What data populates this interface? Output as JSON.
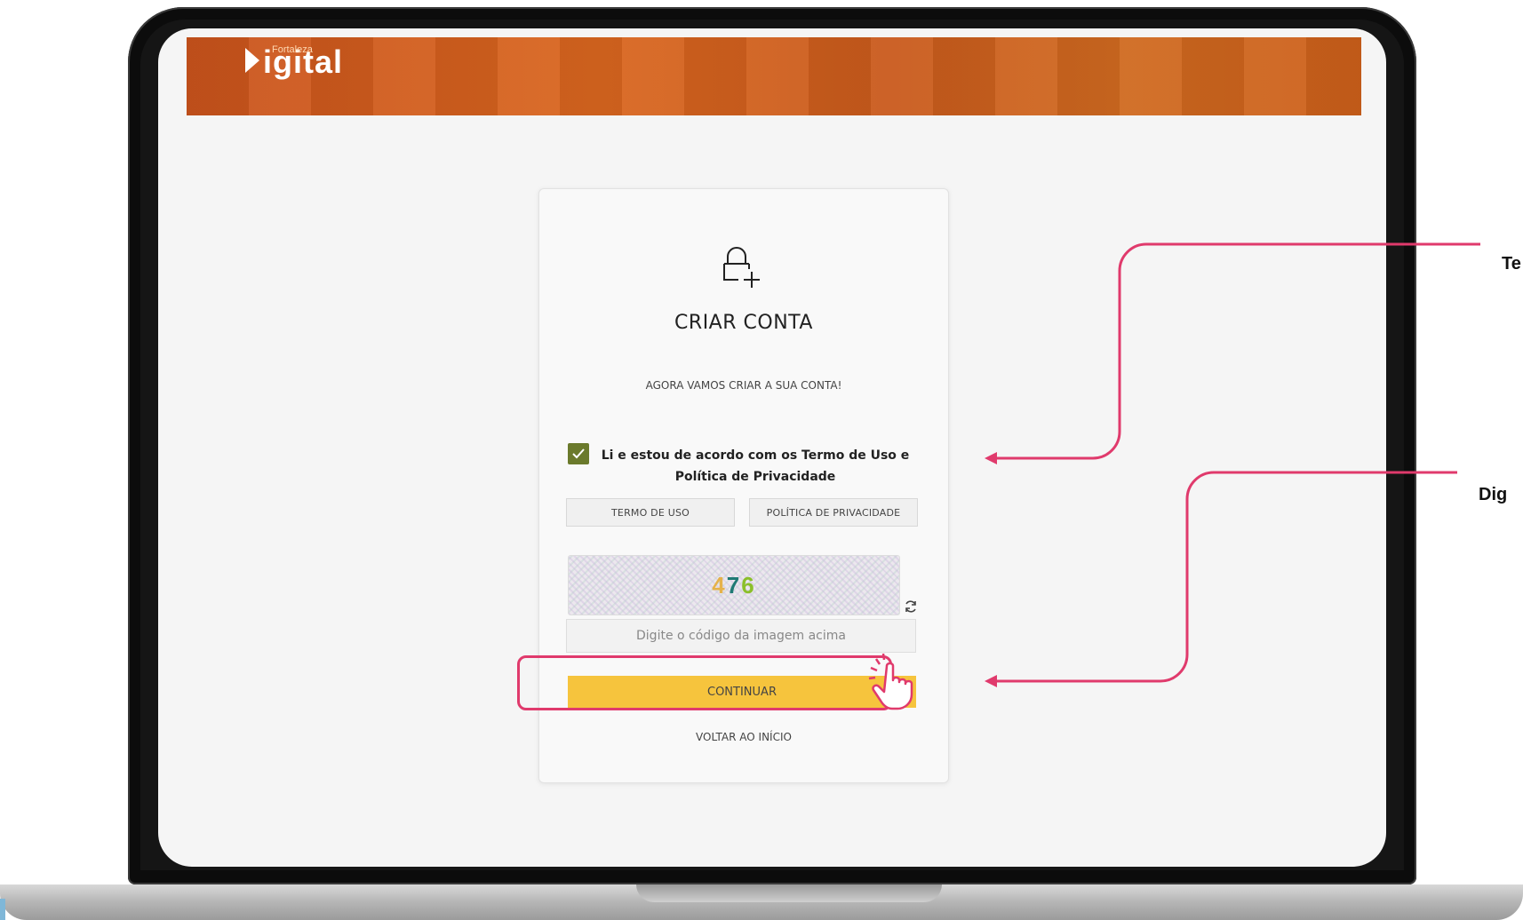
{
  "header": {
    "logo_small": "Fortaleza",
    "logo_main": "igital"
  },
  "card": {
    "title": "CRIAR CONTA",
    "subtitle": "AGORA VAMOS CRIAR A SUA CONTA!",
    "checkbox_label": "Li e estou de acordo com os Termo de Uso e Política de Privacidade",
    "checkbox_checked": true,
    "terms_button": "TERMO DE USO",
    "privacy_button": "POLÍTICA DE PRIVACIDADE",
    "captcha_digits": [
      "4",
      "7",
      "6"
    ],
    "code_input": {
      "value": "",
      "placeholder": "Digite o código da imagem acima"
    },
    "continue_button": "CONTINUAR",
    "back_link": "VOLTAR AO INÍCIO"
  },
  "callouts": [
    {
      "text": "Te"
    },
    {
      "text": "Dig"
    }
  ],
  "colors": {
    "header_orange": "#d9661f",
    "checkbox_green": "#6b7a2c",
    "continue_yellow": "#f6c43d",
    "annotation_pink": "#e03a6c"
  },
  "icons": [
    "lock-plus-icon",
    "check-icon",
    "refresh-icon",
    "hand-pointer-icon"
  ]
}
